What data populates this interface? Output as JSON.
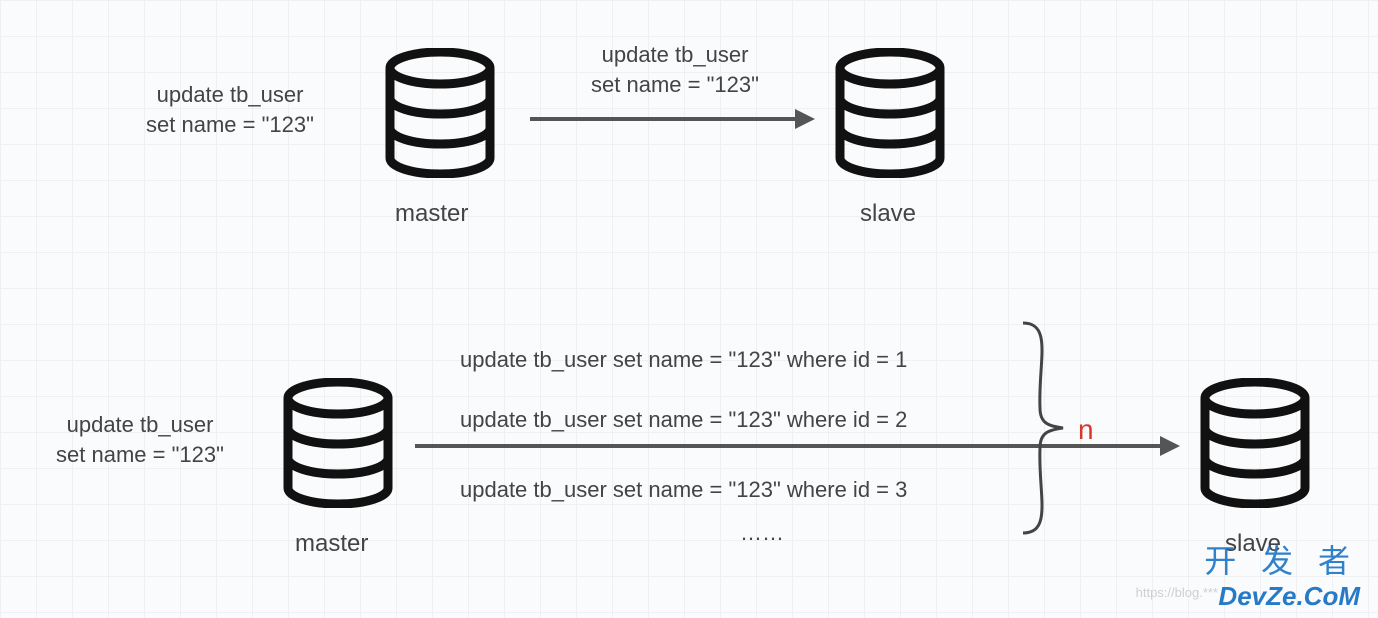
{
  "top": {
    "input_sql": {
      "line1": "update tb_user",
      "line2": "set name = \"123\""
    },
    "master_label": "master",
    "replicated_sql": {
      "line1": "update tb_user",
      "line2": "set name = \"123\""
    },
    "slave_label": "slave"
  },
  "bottom": {
    "input_sql": {
      "line1": "update tb_user",
      "line2": "set name = \"123\""
    },
    "master_label": "master",
    "expanded_sql": [
      "update tb_user set name = \"123\" where id = 1",
      "update tb_user set name = \"123\" where id = 2",
      "update tb_user set name = \"123\" where id = 3"
    ],
    "ellipsis": "……",
    "n_label": "n",
    "slave_label": "slave"
  },
  "watermark": {
    "cn": "开 发 者",
    "en": "DevZe.CoM",
    "url": "https://blog.***"
  }
}
